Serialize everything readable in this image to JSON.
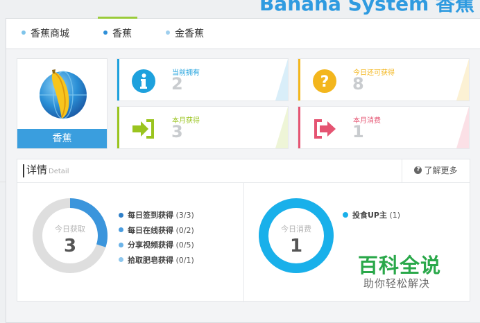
{
  "header": {
    "title": "Banana System 香蕉"
  },
  "tabs": [
    {
      "label": "香蕉商城",
      "dot_color": "#7fc4ea"
    },
    {
      "label": "香蕉",
      "dot_color": "#2f8fd8",
      "active": true
    },
    {
      "label": "金香蕉",
      "dot_color": "#9fcfee"
    }
  ],
  "profile": {
    "name": "香蕉",
    "icon": "banana-globe-icon"
  },
  "stats": [
    {
      "label": "当前拥有",
      "value": "2",
      "color": "#1ea1dd",
      "icon": "info-icon"
    },
    {
      "label": "今日还可获得",
      "value": "8",
      "color": "#f3b61d",
      "icon": "question-icon"
    },
    {
      "label": "本月获得",
      "value": "3",
      "color": "#9ac41f",
      "icon": "sign-in-icon"
    },
    {
      "label": "本月消费",
      "value": "1",
      "color": "#e55472",
      "icon": "sign-out-icon"
    }
  ],
  "detail": {
    "title": "详情",
    "subtitle": "Detail",
    "more_label": "了解更多",
    "left_donut": {
      "center_label": "今日获取",
      "center_value": "3",
      "fraction": 0.3,
      "color": "#3b95dc",
      "track_color": "#dedede"
    },
    "left_legend": [
      {
        "label": "每日签到获得",
        "count": "(3/3)",
        "color": "#2f7fc8"
      },
      {
        "label": "每日在线获得",
        "count": "(0/2)",
        "color": "#4a9de0"
      },
      {
        "label": "分享视频获得",
        "count": "(0/5)",
        "color": "#6bb3e8"
      },
      {
        "label": "拾取肥皂获得",
        "count": "(0/1)",
        "color": "#8ec7ee"
      }
    ],
    "right_donut": {
      "center_label": "今日消费",
      "center_value": "1",
      "fraction": 1.0,
      "color": "#19b0ea"
    },
    "right_legend": [
      {
        "label": "投食UP主",
        "count": "(1)",
        "color": "#19b0ea"
      }
    ]
  },
  "watermark": {
    "title": "百科全说",
    "subtitle": "助你轻松解决"
  }
}
